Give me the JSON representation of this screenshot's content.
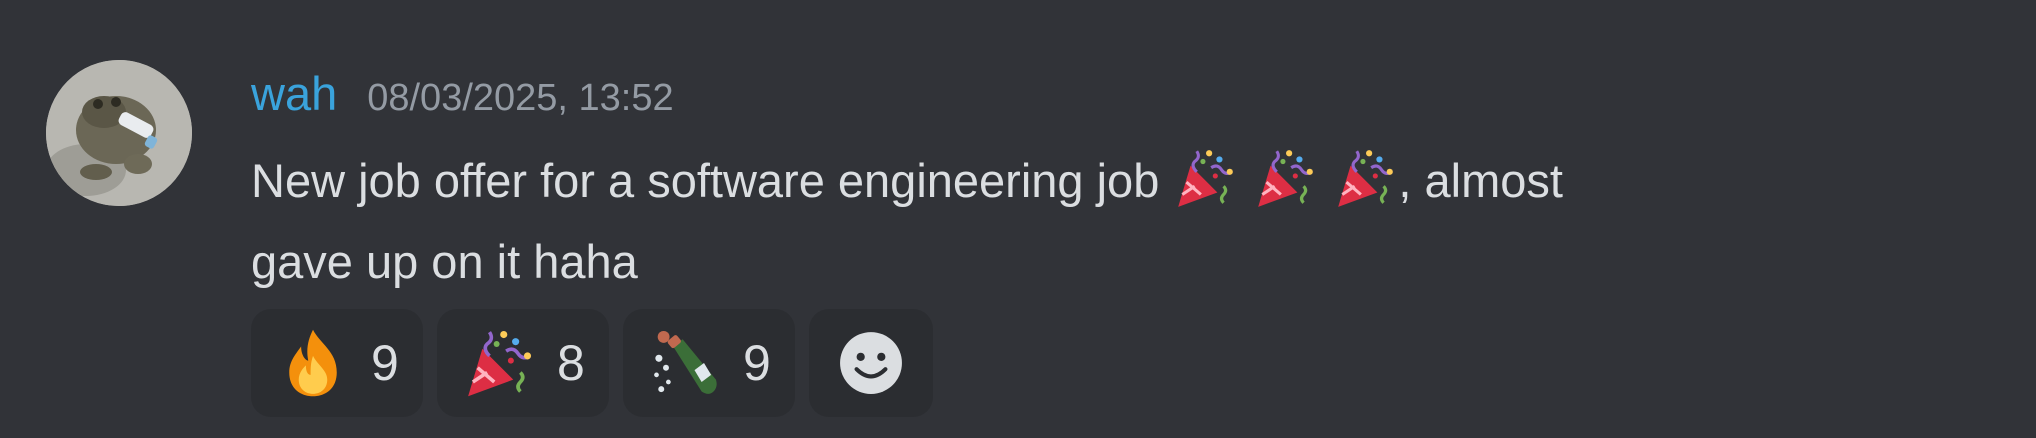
{
  "message": {
    "author": "wah",
    "timestamp": "08/03/2025, 13:52",
    "text_line1_before": "New job offer for a software engineering job",
    "text_line1_after": ", almost",
    "text_line2": "gave up on it haha",
    "inline_emojis": [
      "party-popper-icon",
      "party-popper-icon",
      "party-popper-icon"
    ]
  },
  "reactions": [
    {
      "emoji": "fire-icon",
      "count": "9"
    },
    {
      "emoji": "party-popper-icon",
      "count": "8"
    },
    {
      "emoji": "champagne-bottle-icon",
      "count": "9"
    }
  ],
  "add_reaction": {
    "icon": "add-reaction-smiley-icon"
  },
  "colors": {
    "background": "#313338",
    "username": "#3aa3dc",
    "timestamp": "#949ba4",
    "text": "#dbdee1",
    "reaction_bg": "#2b2d31"
  }
}
